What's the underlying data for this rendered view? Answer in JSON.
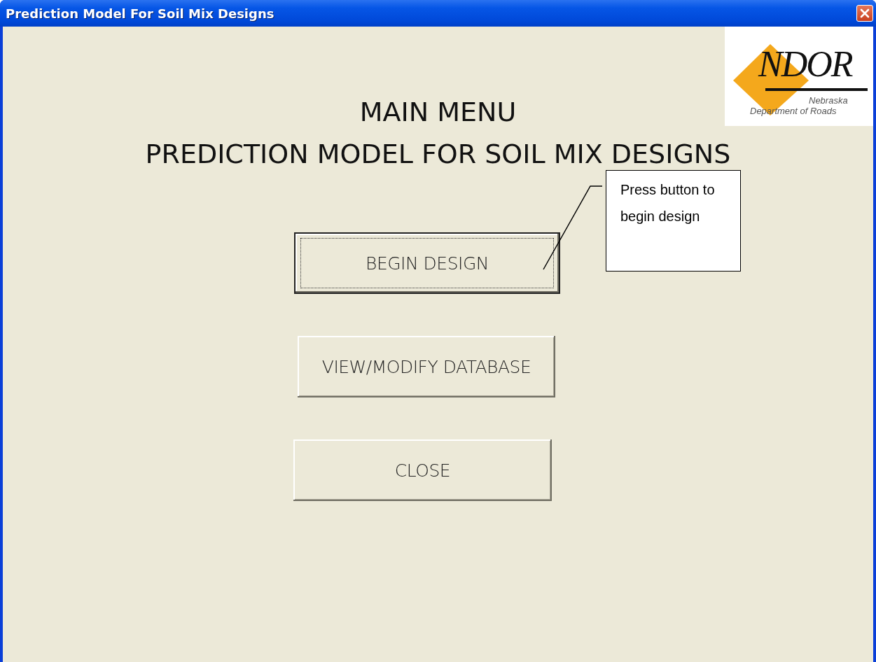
{
  "window": {
    "title": "Prediction Model For Soil Mix Designs"
  },
  "logo": {
    "mark": "NDOR",
    "line_1": "Nebraska",
    "line_2": "Department of Roads"
  },
  "headings": [
    "MAIN MENU",
    "PREDICTION MODEL FOR SOIL MIX DESIGNS"
  ],
  "buttons": [
    {
      "label": "BEGIN DESIGN",
      "focused": true
    },
    {
      "label": "VIEW/MODIFY DATABASE",
      "focused": false
    },
    {
      "label": "CLOSE",
      "focused": false
    }
  ],
  "callout": {
    "text": "Press button to begin design"
  }
}
